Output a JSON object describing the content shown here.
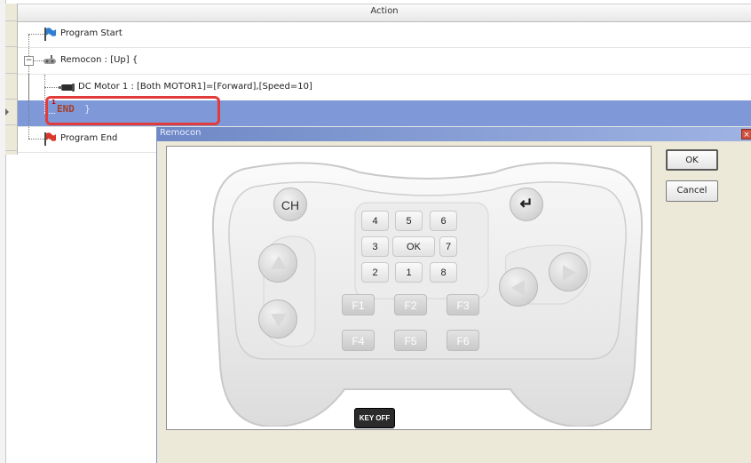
{
  "grid": {
    "column_header": "Action",
    "rows": [
      {
        "label": "Program Start",
        "icon": "blue-flag-icon"
      },
      {
        "label": "Remocon : [Up] {",
        "icon": "remocon-icon"
      },
      {
        "label": "DC Motor 1 : [Both MOTOR1]=[Forward],[Speed=10]",
        "icon": "dc-motor-icon"
      },
      {
        "label": "END",
        "suffix": "}",
        "marker": "1",
        "icon": "none"
      },
      {
        "label": "Program End",
        "icon": "red-flag-icon"
      }
    ],
    "expander": "−"
  },
  "dialog": {
    "title": "Remocon",
    "close": "×",
    "ok_label": "OK",
    "cancel_label": "Cancel",
    "remote": {
      "ch_label": "CH",
      "enter_glyph": "↵",
      "numpad": [
        "4",
        "5",
        "6",
        "3",
        "OK",
        "7",
        "2",
        "1",
        "8"
      ],
      "function_keys": [
        "F1",
        "F2",
        "F3",
        "F4",
        "F5",
        "F6"
      ],
      "key_off_label": "KEY OFF"
    }
  },
  "colors": {
    "selection": "#7f99d8",
    "highlight_border": "#e23b3b",
    "dialog_title": "#6f89c6",
    "end_text": "#a4402a"
  }
}
